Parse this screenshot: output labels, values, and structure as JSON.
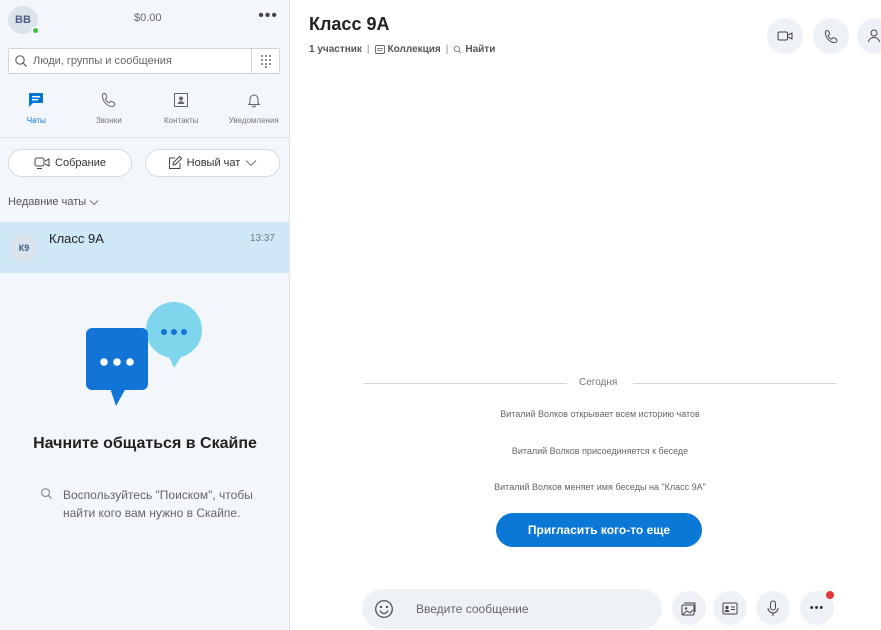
{
  "profile": {
    "initials": "ВВ",
    "balance": "$0.00",
    "more_label": "•••"
  },
  "search": {
    "placeholder": "Люди, группы и сообщения"
  },
  "nav": {
    "tabs": [
      {
        "label": "Чаты",
        "icon": "chat-icon",
        "active": true
      },
      {
        "label": "Звонки",
        "icon": "phone-icon",
        "active": false
      },
      {
        "label": "Контакты",
        "icon": "contacts-icon",
        "active": false
      },
      {
        "label": "Уведомления",
        "icon": "bell-icon",
        "active": false
      }
    ]
  },
  "actions": {
    "meeting_label": "Собрание",
    "new_chat_label": "Новый чат"
  },
  "recent": {
    "label": "Недавние чаты"
  },
  "chats": [
    {
      "initials": "К9",
      "name": "Класс 9А",
      "time": "13:37",
      "selected": true
    }
  ],
  "empty_state": {
    "title": "Начните общаться в Скайпе",
    "hint": "Воспользуйтесь \"Поиском\", чтобы найти кого вам нужно в Скайпе."
  },
  "conversation": {
    "title": "Класс 9А",
    "participants": "1 участник",
    "gallery_label": "Коллекция",
    "find_label": "Найти",
    "day_label": "Сегодня",
    "system_messages": [
      "Виталий Волков открывает всем историю чатов",
      "Виталий Волков присоединяется к беседе",
      "Виталий Волков меняет имя беседы на \"Класс 9А\""
    ],
    "invite_label": "Пригласить кого-то еще"
  },
  "composer": {
    "placeholder": "Введите сообщение",
    "more_label": "•••"
  },
  "colors": {
    "accent": "#0a78d4",
    "selected_row": "#cfe8f7",
    "sidebar_bg": "#f3f6fa",
    "presence": "#4cb94c",
    "notification": "#e5383b",
    "bubble_dark": "#1174d6",
    "bubble_light": "#7fd6ec"
  }
}
